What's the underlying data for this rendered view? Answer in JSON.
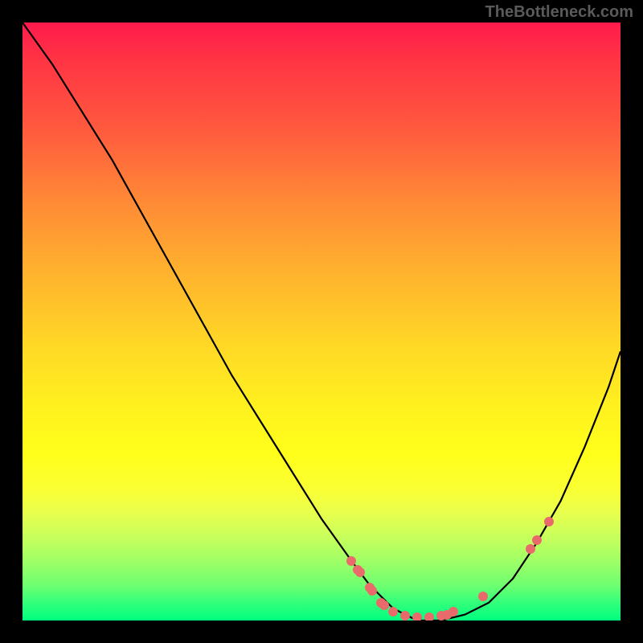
{
  "watermark": "TheBottleneck.com",
  "chart_data": {
    "type": "line",
    "title": "",
    "xlabel": "",
    "ylabel": "",
    "xlim": [
      0,
      100
    ],
    "ylim": [
      0,
      100
    ],
    "grid": false,
    "series": [
      {
        "name": "curve",
        "x": [
          0,
          5,
          10,
          15,
          20,
          25,
          30,
          35,
          40,
          45,
          50,
          55,
          58,
          62,
          66,
          70,
          74,
          78,
          82,
          86,
          90,
          94,
          98,
          100
        ],
        "y": [
          100,
          93,
          85,
          77,
          68,
          59,
          50,
          41,
          33,
          25,
          17,
          10,
          6,
          2,
          0,
          0,
          1,
          3,
          7,
          13,
          20,
          29,
          39,
          45
        ]
      }
    ],
    "highlight_points": [
      {
        "x": 55,
        "y": 10
      },
      {
        "x": 56,
        "y": 8.5
      },
      {
        "x": 56.5,
        "y": 8
      },
      {
        "x": 58,
        "y": 5.5
      },
      {
        "x": 58.5,
        "y": 5
      },
      {
        "x": 60,
        "y": 3
      },
      {
        "x": 60.5,
        "y": 2.5
      },
      {
        "x": 62,
        "y": 1.5
      },
      {
        "x": 64,
        "y": 0.8
      },
      {
        "x": 66,
        "y": 0.5
      },
      {
        "x": 68,
        "y": 0.5
      },
      {
        "x": 70,
        "y": 0.8
      },
      {
        "x": 71,
        "y": 1
      },
      {
        "x": 72,
        "y": 1.5
      },
      {
        "x": 77,
        "y": 4
      },
      {
        "x": 85,
        "y": 12
      },
      {
        "x": 86,
        "y": 13.5
      },
      {
        "x": 88,
        "y": 16.5
      }
    ]
  }
}
